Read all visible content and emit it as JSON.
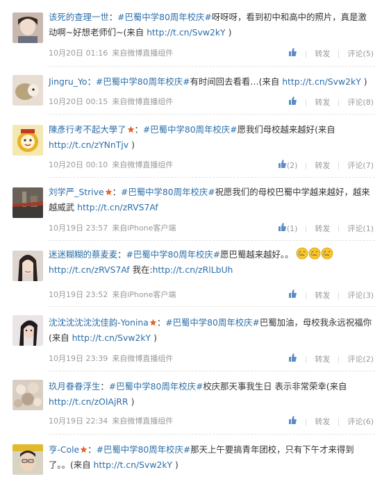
{
  "colors": {
    "link": "#2b6ea8",
    "meta": "#999999",
    "accent_vip": "#e0632a"
  },
  "posts": [
    {
      "name": "该死的查理一世",
      "vip": false,
      "sep": "：",
      "topic": "#巴蜀中学80周年校庆#",
      "text": "呀呀呀，看到初中和高中的照片，真是激动啊~好想老师们~(来自 ",
      "link": "http://t.cn/Svw2kY",
      "tail": " )",
      "time": "10月20日 01:16",
      "source": "来自微博直播组件",
      "like": "",
      "repost": "转发",
      "comment": "评论(5)"
    },
    {
      "name": "Jingru_Yo",
      "vip": false,
      "sep": "：",
      "topic": "#巴蜀中学80周年校庆#",
      "text": "有时间回去看看…(来自 ",
      "link": "http://t.cn/Svw2kY",
      "tail": " )",
      "time": "10月20日 00:15",
      "source": "来自微博直播组件",
      "like": "",
      "repost": "转发",
      "comment": "评论(8)"
    },
    {
      "name": "陳彥行考不起大學了",
      "vip": true,
      "sep": "：",
      "topic": "#巴蜀中学80周年校庆#",
      "text": "愿我们母校越来越好(来自 ",
      "link": "http://t.cn/zYNnTjv",
      "tail": " )",
      "time": "10月20日 00:10",
      "source": "来自微博直播组件",
      "like": "(2)",
      "repost": "转发",
      "comment": "评论(7)"
    },
    {
      "name": "刘学严_Strive",
      "vip": true,
      "sep": "：",
      "topic": "#巴蜀中学80周年校庆#",
      "text": "祝愿我们的母校巴蜀中学越来越好，越来越威武 ",
      "link": "http://t.cn/zRVS7Af",
      "tail": "",
      "time": "10月19日 23:57",
      "source": "来自iPhone客户端",
      "like": "(1)",
      "repost": "转发",
      "comment": "评论(1)"
    },
    {
      "name": "迷迷糊糊的蔡麦麦",
      "vip": false,
      "sep": "：",
      "topic": "#巴蜀中学80周年校庆#",
      "text": "愿巴蜀越来越好。。",
      "emoji_count": 3,
      "link": "http://t.cn/zRVS7Af",
      "text2": " 我在:",
      "link2": "http://t.cn/zRlLbUh",
      "tail": "",
      "time": "10月19日 23:52",
      "source": "来自iPhone客户端",
      "like": "",
      "repost": "转发",
      "comment": "评论(3)"
    },
    {
      "name": "沈沈沈沈沈沈佳韵-Yonina",
      "vip": true,
      "sep": "：",
      "topic": "#巴蜀中学80周年校庆#",
      "text": "巴蜀加油，母校我永远祝福你(来自 ",
      "link": "http://t.cn/Svw2kY",
      "tail": " )",
      "time": "10月19日 23:39",
      "source": "来自微博直播组件",
      "like": "",
      "repost": "转发",
      "comment": "评论(2)"
    },
    {
      "name": "玖月眷眷浮生",
      "vip": false,
      "sep": "：",
      "topic": "#巴蜀中学80周年校庆#",
      "text": "校庆那天事我生日 表示非常荣幸(来自 ",
      "link": "http://t.cn/zOIAjRR",
      "tail": " )",
      "time": "10月19日 22:34",
      "source": "来自微博直播组件",
      "like": "",
      "repost": "转发",
      "comment": "评论(6)"
    },
    {
      "name": "亨-Cole",
      "vip": true,
      "sep": "：",
      "topic": "#巴蜀中学80周年校庆#",
      "text": "那天上午要搞青年团校，只有下午才来得到了。。(来自 ",
      "link": "http://t.cn/Svw2kY",
      "tail": " )",
      "time": "",
      "source": "",
      "like": "",
      "repost": "",
      "comment": ""
    }
  ]
}
